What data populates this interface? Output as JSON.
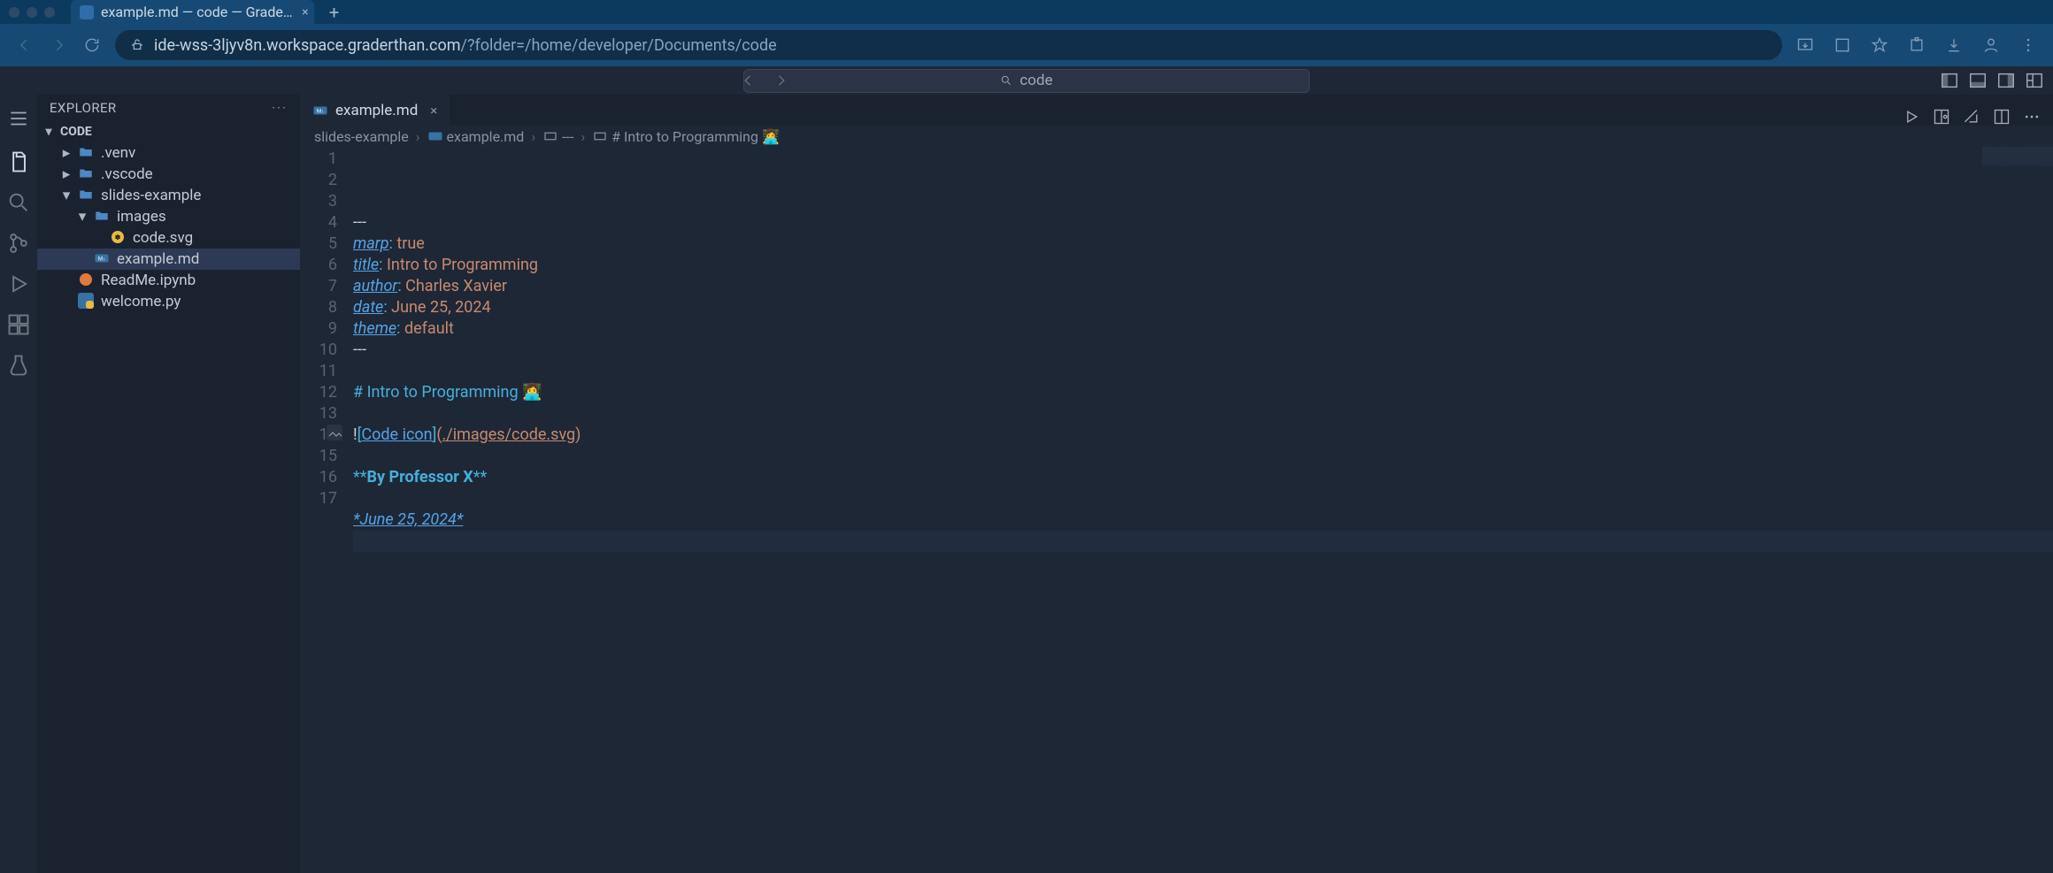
{
  "browser": {
    "tab_title": "example.md — code — Grade…",
    "url_host": "ide-wss-3ljyv8n.workspace.graderthan.com",
    "url_path": "/?folder=/home/developer/Documents/code"
  },
  "vsc": {
    "search_placeholder": "code",
    "sidebar_title": "EXPLORER",
    "section_label": "CODE"
  },
  "tree": [
    {
      "name": ".venv",
      "kind": "folder",
      "depth": 1,
      "expanded": false
    },
    {
      "name": ".vscode",
      "kind": "folder",
      "depth": 1,
      "expanded": false
    },
    {
      "name": "slides-example",
      "kind": "folder",
      "depth": 1,
      "expanded": true
    },
    {
      "name": "images",
      "kind": "folder",
      "depth": 2,
      "expanded": true
    },
    {
      "name": "code.svg",
      "kind": "svg",
      "depth": 3
    },
    {
      "name": "example.md",
      "kind": "md",
      "depth": 2,
      "selected": true
    },
    {
      "name": "ReadMe.ipynb",
      "kind": "ipynb",
      "depth": 1
    },
    {
      "name": "welcome.py",
      "kind": "py",
      "depth": 1
    }
  ],
  "tab": {
    "label": "example.md"
  },
  "breadcrumb": [
    {
      "text": "slides-example"
    },
    {
      "text": "example.md",
      "icon": "md"
    },
    {
      "text": "---",
      "icon": "sym"
    },
    {
      "text": "# Intro to Programming 👩‍💻",
      "icon": "sym"
    }
  ],
  "code": {
    "lines": [
      {
        "n": 1,
        "seg": [
          {
            "t": "---",
            "c": "c-txt"
          }
        ]
      },
      {
        "n": 2,
        "seg": [
          {
            "t": "marp",
            "c": "c-emp"
          },
          {
            "t": ":",
            "c": "c-col"
          },
          {
            "t": " "
          },
          {
            "t": "true",
            "c": "c-str"
          }
        ]
      },
      {
        "n": 3,
        "seg": [
          {
            "t": "title",
            "c": "c-emp"
          },
          {
            "t": ":",
            "c": "c-col"
          },
          {
            "t": " Intro to Programming",
            "c": "c-str"
          }
        ]
      },
      {
        "n": 4,
        "seg": [
          {
            "t": "author",
            "c": "c-emp"
          },
          {
            "t": ":",
            "c": "c-col"
          },
          {
            "t": " Charles Xavier",
            "c": "c-str"
          }
        ]
      },
      {
        "n": 5,
        "seg": [
          {
            "t": "date",
            "c": "c-emp"
          },
          {
            "t": ":",
            "c": "c-col"
          },
          {
            "t": " June 25, 2024",
            "c": "c-str"
          }
        ]
      },
      {
        "n": 6,
        "seg": [
          {
            "t": "theme",
            "c": "c-emp"
          },
          {
            "t": ":",
            "c": "c-col"
          },
          {
            "t": " default",
            "c": "c-str"
          }
        ]
      },
      {
        "n": 7,
        "seg": [
          {
            "t": "---",
            "c": "c-txt"
          }
        ]
      },
      {
        "n": 8,
        "seg": []
      },
      {
        "n": 9,
        "seg": [
          {
            "t": "# ",
            "c": "c-col"
          },
          {
            "t": "Intro to Programming 👩‍💻",
            "c": "c-col"
          }
        ]
      },
      {
        "n": 10,
        "seg": []
      },
      {
        "n": 11,
        "seg": [
          {
            "t": "!",
            "c": "c-txt"
          },
          {
            "t": "[",
            "c": "c-col"
          },
          {
            "t": "Code icon",
            "c": "c-key"
          },
          {
            "t": "]",
            "c": "c-col"
          },
          {
            "t": "(",
            "c": "c-str"
          },
          {
            "t": "./images/code.svg",
            "c": "c-lnk"
          },
          {
            "t": ")",
            "c": "c-str"
          }
        ],
        "glyph": true
      },
      {
        "n": 12,
        "seg": []
      },
      {
        "n": 13,
        "seg": [
          {
            "t": "**",
            "c": "c-col"
          },
          {
            "t": "By Professor X",
            "c": "c-bold"
          },
          {
            "t": "**",
            "c": "c-col"
          }
        ]
      },
      {
        "n": 14,
        "seg": []
      },
      {
        "n": 15,
        "seg": [
          {
            "t": "*June 25, 2024*",
            "c": "c-emp"
          }
        ]
      },
      {
        "n": 16,
        "seg": [],
        "current": true
      },
      {
        "n": 17,
        "seg": []
      }
    ]
  }
}
